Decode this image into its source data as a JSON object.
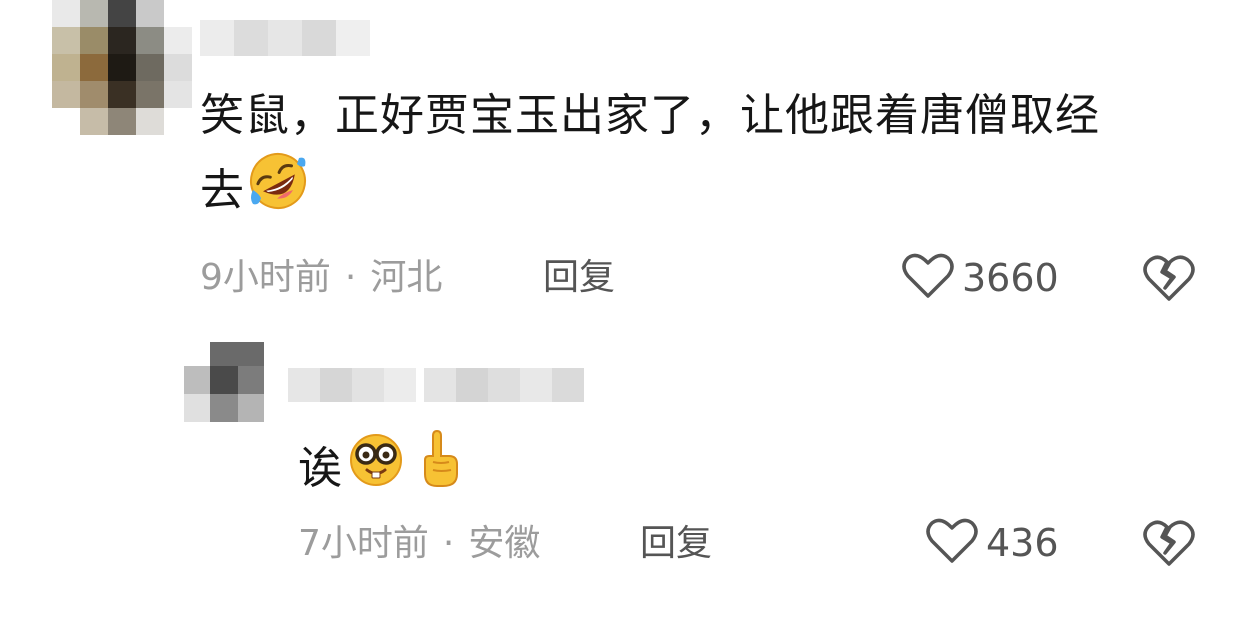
{
  "comments": [
    {
      "text_line1": "笑鼠，正好贾宝玉出家了，让他跟着唐僧取经",
      "text_line2": "去",
      "emoji_1": "rolling-on-floor-laughing-icon",
      "time": "9小时前",
      "separator": "·",
      "location": "河北",
      "reply_label": "回复",
      "likes": "3660"
    },
    {
      "text": "诶",
      "emoji_1": "nerd-face-icon",
      "emoji_2": "index-pointing-up-icon",
      "time": "7小时前",
      "separator": "·",
      "location": "安徽",
      "reply_label": "回复",
      "likes": "436"
    }
  ],
  "colors": {
    "text": "#161616",
    "meta": "#9c9c9c",
    "action": "#555555"
  }
}
